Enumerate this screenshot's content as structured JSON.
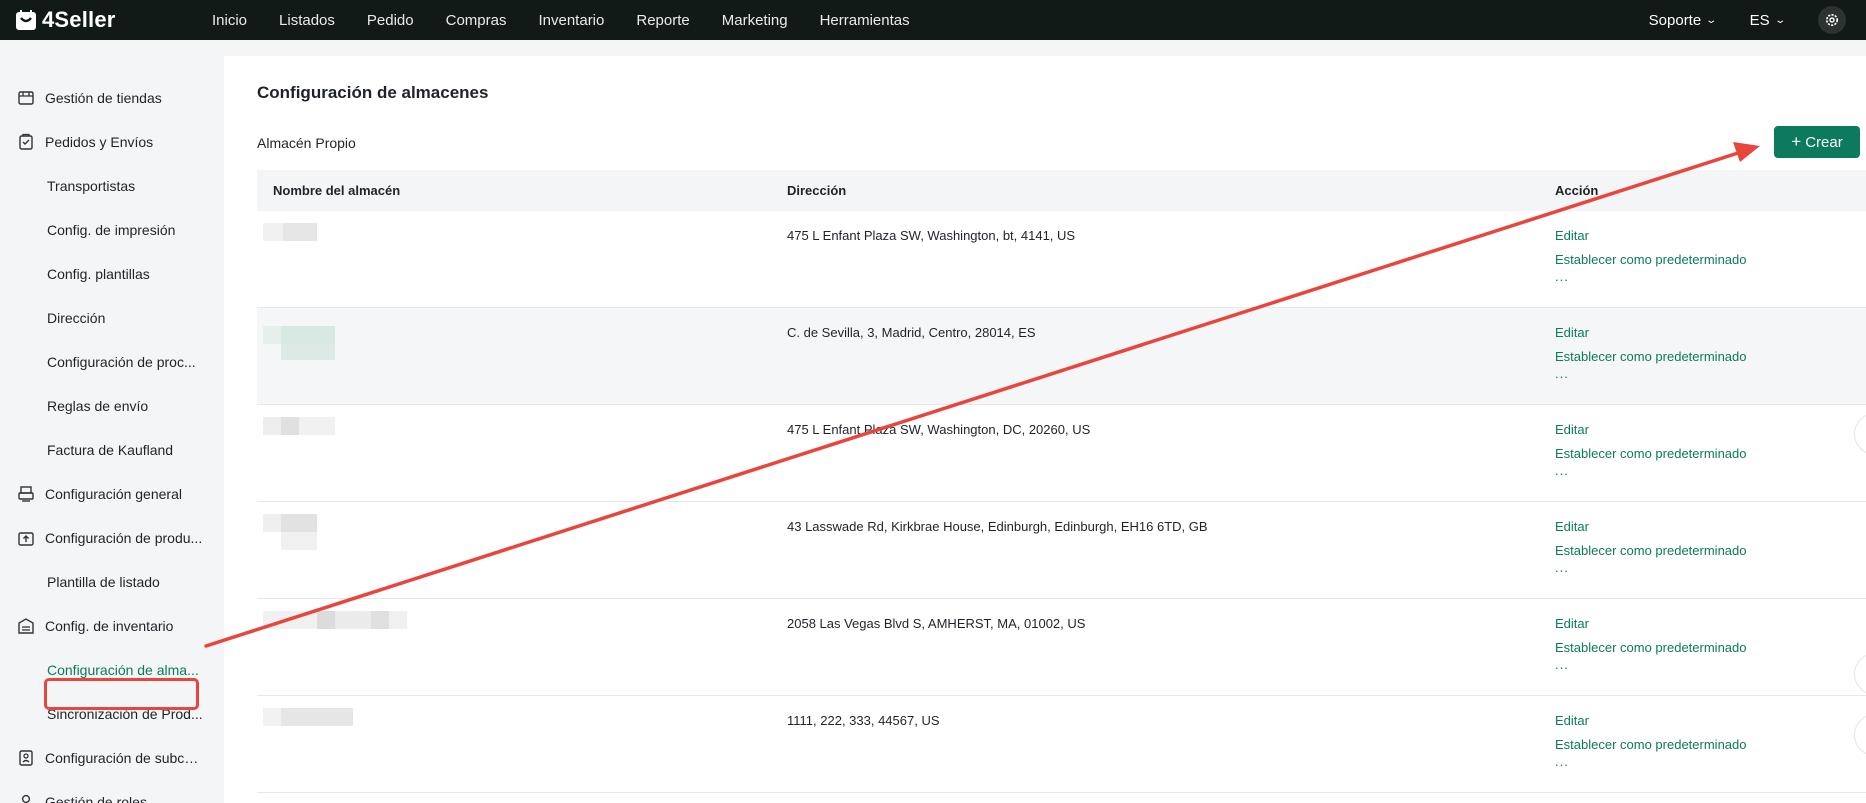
{
  "app": {
    "brand": "4Seller",
    "nav": [
      "Inicio",
      "Listados",
      "Pedido",
      "Compras",
      "Inventario",
      "Reporte",
      "Marketing",
      "Herramientas"
    ],
    "support_label": "Soporte",
    "language_label": "ES"
  },
  "sidebar": {
    "items": [
      {
        "label": "Gestión de tiendas",
        "icon": "store-icon",
        "kind": "group"
      },
      {
        "label": "Pedidos y Envíos",
        "icon": "clipboard-icon",
        "kind": "group"
      },
      {
        "label": "Transportistas",
        "kind": "sub"
      },
      {
        "label": "Config. de impresión",
        "kind": "sub"
      },
      {
        "label": "Config. plantillas",
        "kind": "sub"
      },
      {
        "label": "Dirección",
        "kind": "sub"
      },
      {
        "label": "Configuración de proc...",
        "kind": "sub"
      },
      {
        "label": "Reglas de envío",
        "kind": "sub"
      },
      {
        "label": "Factura de Kaufland",
        "kind": "sub"
      },
      {
        "label": "Configuración general",
        "icon": "printer-icon",
        "kind": "group"
      },
      {
        "label": "Configuración de produ...",
        "icon": "box-upload-icon",
        "kind": "group"
      },
      {
        "label": "Plantilla de listado",
        "kind": "sub"
      },
      {
        "label": "Config. de inventario",
        "icon": "warehouse-icon",
        "kind": "group"
      },
      {
        "label": "Configuración de alma...",
        "kind": "sub",
        "active": true
      },
      {
        "label": "Sincronización de Prod...",
        "kind": "sub"
      },
      {
        "label": "Configuración de subcu...",
        "icon": "id-card-icon",
        "kind": "group"
      },
      {
        "label": "Gestión de roles",
        "icon": "user-icon",
        "kind": "group"
      }
    ]
  },
  "main": {
    "title": "Configuración de almacenes",
    "section_label": "Almacén Propio",
    "create_label": "Crear",
    "columns": [
      "Nombre del almacén",
      "Dirección",
      "Acción"
    ],
    "rows": [
      {
        "address": "475 L Enfant Plaza SW, Washington, bt, 4141, US"
      },
      {
        "address": "C. de Sevilla, 3, Madrid, Centro, 28014, ES"
      },
      {
        "address": "475 L Enfant Plaza SW, Washington, DC, 20260, US"
      },
      {
        "address": "43 Lasswade Rd, Kirkbrae House, Edinburgh, Edinburgh, EH16 6TD, GB"
      },
      {
        "address": "2058 Las Vegas Blvd S, AMHERST, MA, 01002, US"
      },
      {
        "address": "1111, 222, 333, 44567, US"
      }
    ],
    "actions": {
      "edit": "Editar",
      "set_default": "Establecer como predeterminado",
      "more": "..."
    }
  },
  "colors": {
    "accent": "#0c7a5d",
    "topbar": "#111a16",
    "annotation": "#e8463d"
  }
}
